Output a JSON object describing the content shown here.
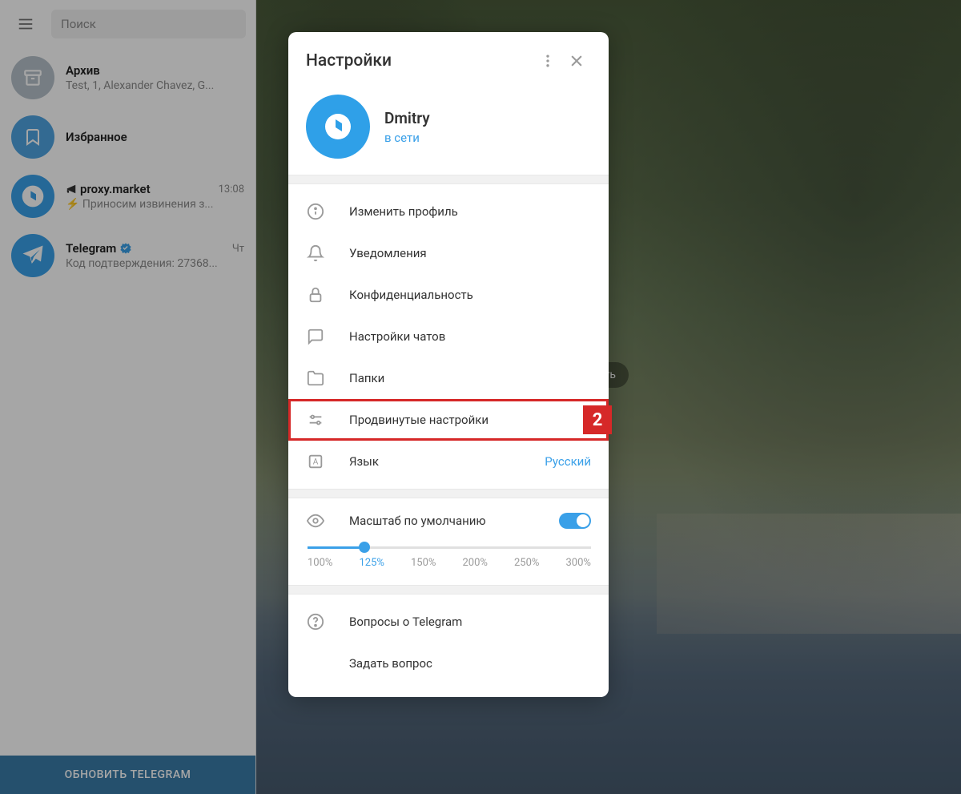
{
  "sidebar": {
    "search_placeholder": "Поиск",
    "chats": [
      {
        "title": "Архив",
        "preview": "Test, 1, Alexander Chavez, G...",
        "time": ""
      },
      {
        "title": "Избранное",
        "preview": "",
        "time": ""
      },
      {
        "title": "proxy.market",
        "preview": "⚡ Приносим извинения з...",
        "time": "13:08",
        "megaphone": true
      },
      {
        "title": "Telegram",
        "preview": "Код подтверждения: 27368...",
        "time": "Чт",
        "verified": true
      }
    ],
    "update_label": "ОБНОВИТЬ TELEGRAM"
  },
  "write_button": "аписать",
  "modal": {
    "title": "Настройки",
    "profile": {
      "name": "Dmitry",
      "status": "в сети"
    },
    "items": [
      {
        "icon": "info",
        "label": "Изменить профиль"
      },
      {
        "icon": "bell",
        "label": "Уведомления"
      },
      {
        "icon": "lock",
        "label": "Конфиденциальность"
      },
      {
        "icon": "chat",
        "label": "Настройки чатов"
      },
      {
        "icon": "folder",
        "label": "Папки"
      },
      {
        "icon": "sliders",
        "label": "Продвинутые настройки",
        "highlight": "2"
      },
      {
        "icon": "lang",
        "label": "Язык",
        "value": "Русский"
      }
    ],
    "scale": {
      "label": "Масштаб по умолчанию",
      "options": [
        "100%",
        "125%",
        "150%",
        "200%",
        "250%",
        "300%"
      ],
      "selected": "125%"
    },
    "footer": [
      {
        "icon": "help",
        "label": "Вопросы о Telegram"
      },
      {
        "icon": "",
        "label": "Задать вопрос"
      }
    ]
  }
}
